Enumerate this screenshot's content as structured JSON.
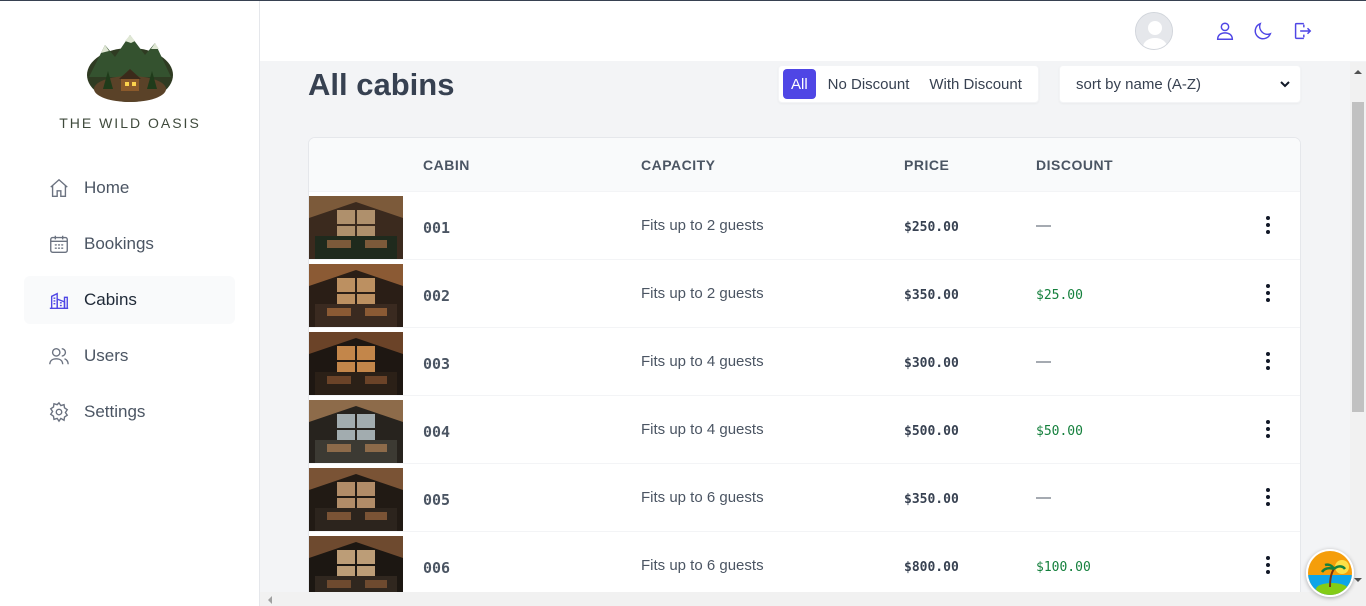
{
  "brand": {
    "name": "THE WILD OASIS"
  },
  "sidebar": {
    "items": [
      {
        "label": "Home",
        "icon": "home-icon",
        "active": false
      },
      {
        "label": "Bookings",
        "icon": "calendar-icon",
        "active": false
      },
      {
        "label": "Cabins",
        "icon": "buildings-icon",
        "active": true
      },
      {
        "label": "Users",
        "icon": "users-icon",
        "active": false
      },
      {
        "label": "Settings",
        "icon": "gear-icon",
        "active": false
      }
    ]
  },
  "header": {
    "icons": [
      "user-icon",
      "moon-icon",
      "logout-icon"
    ]
  },
  "main": {
    "title": "All cabins",
    "filter": {
      "options": [
        "All",
        "No Discount",
        "With Discount"
      ],
      "active": "All"
    },
    "sort": {
      "selected": "sort by name (A-Z)"
    }
  },
  "table": {
    "columns": [
      "",
      "CABIN",
      "CAPACITY",
      "PRICE",
      "DISCOUNT"
    ],
    "rows": [
      {
        "name": "001",
        "capacity": "Fits up to 2 guests",
        "price": "$250.00",
        "discount": "—"
      },
      {
        "name": "002",
        "capacity": "Fits up to 2 guests",
        "price": "$350.00",
        "discount": "$25.00"
      },
      {
        "name": "003",
        "capacity": "Fits up to 4 guests",
        "price": "$300.00",
        "discount": "—"
      },
      {
        "name": "004",
        "capacity": "Fits up to 4 guests",
        "price": "$500.00",
        "discount": "$50.00"
      },
      {
        "name": "005",
        "capacity": "Fits up to 6 guests",
        "price": "$350.00",
        "discount": "—"
      },
      {
        "name": "006",
        "capacity": "Fits up to 6 guests",
        "price": "$800.00",
        "discount": "$100.00"
      }
    ]
  },
  "colors": {
    "accent": "#4f46e5",
    "discount": "#15803d",
    "icon": "#4f46e5"
  }
}
